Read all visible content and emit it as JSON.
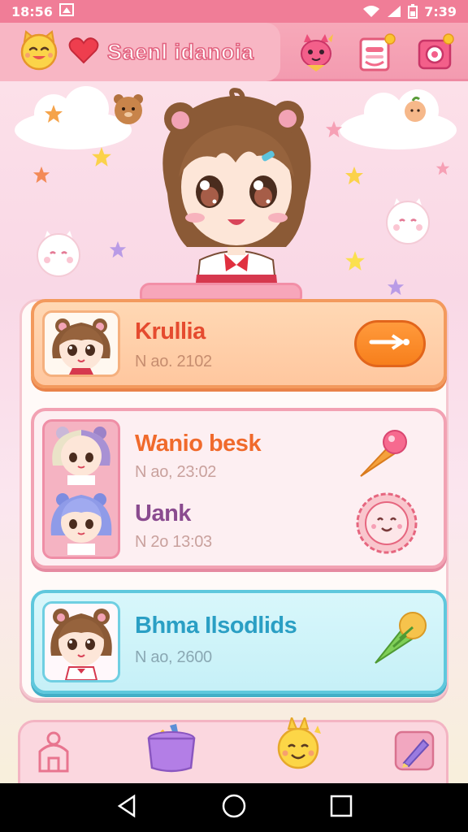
{
  "status_bar": {
    "time_left": "18:56",
    "time_right": "7:39"
  },
  "header": {
    "title": "Saenl idanoia",
    "icons": [
      "cat-face-icon",
      "heart-icon",
      "mascot-icon",
      "inbox-icon",
      "camera-icon"
    ]
  },
  "cards": [
    {
      "name": "Krullia",
      "meta": "N ao. 2102",
      "action_icon": "chat-arrow-icon",
      "theme": "#f39a5d"
    },
    {
      "entries": [
        {
          "name": "Wanio besk",
          "meta": "N ao, 23:02",
          "icon": "ice-cream-icon"
        },
        {
          "name": "Uank",
          "meta": "N 2o 13:03",
          "icon": "smiley-cookie-icon"
        }
      ],
      "theme": "#f2a2b3"
    },
    {
      "name": "Bhma Ilsodlids",
      "meta": "N ao, 2600",
      "action_icon": "drink-icon",
      "theme": "#5fc8dd"
    }
  ],
  "bottom_nav": [
    "home-icon",
    "shop-bag-icon",
    "mascot-bunny-icon",
    "edit-pen-icon"
  ],
  "system_nav": [
    "back-icon",
    "home-circle-icon",
    "recents-icon"
  ]
}
